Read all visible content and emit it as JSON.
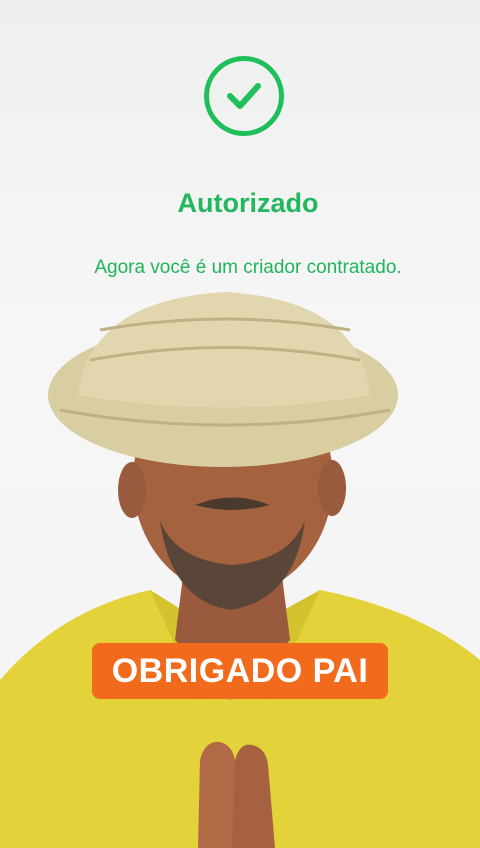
{
  "status": {
    "icon": "check-circle-icon",
    "title": "Autorizado",
    "message": "Agora você é um criador contratado."
  },
  "caption": {
    "text": "OBRIGADO PAI"
  },
  "colors": {
    "accent_green": "#1fbf5a",
    "caption_orange": "#f26a1b",
    "caption_text": "#ffffff"
  }
}
